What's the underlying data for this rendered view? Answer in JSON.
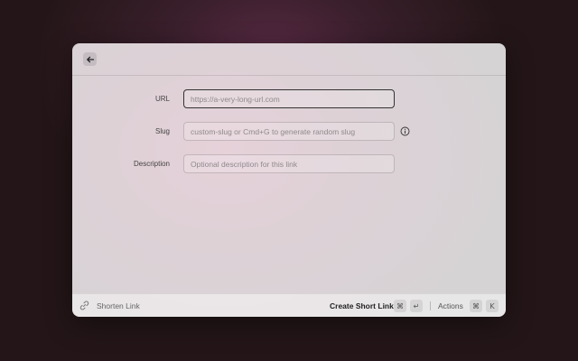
{
  "form": {
    "url": {
      "label": "URL",
      "placeholder": "https://a-very-long-url.com",
      "value": ""
    },
    "slug": {
      "label": "Slug",
      "placeholder": "custom-slug or Cmd+G to generate random slug",
      "value": "",
      "info_icon": "info-circle-icon"
    },
    "description": {
      "label": "Description",
      "placeholder": "Optional description for this link",
      "value": ""
    }
  },
  "footer": {
    "title": "Shorten Link",
    "primary_action": "Create Short Link",
    "primary_keys": [
      "⌘",
      "↵"
    ],
    "actions_label": "Actions",
    "actions_keys": [
      "⌘",
      "K"
    ]
  },
  "icons": {
    "back": "arrow-left-icon",
    "app": "link-icon"
  }
}
